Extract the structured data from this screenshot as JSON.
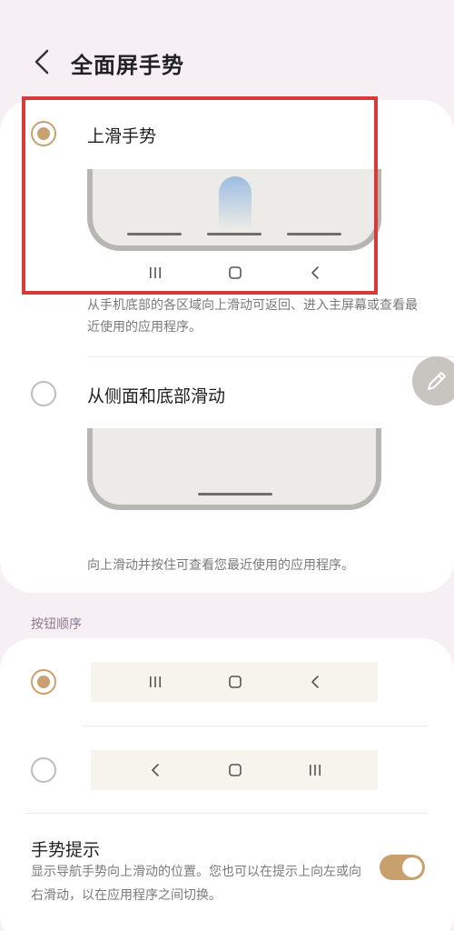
{
  "header": {
    "title": "全面屏手势",
    "back_icon": "chevron-left-icon"
  },
  "gesture_options": [
    {
      "label": "上滑手势",
      "selected": true,
      "description": "从手机底部的各区域向上滑动可返回、进入主屏幕或查看最近使用的应用程序。"
    },
    {
      "label": "从侧面和底部滑动",
      "selected": false,
      "description": "向上滑动并按住可查看您最近使用的应用程序。"
    }
  ],
  "nav_preview": {
    "keys": [
      "recents-icon",
      "home-icon",
      "back-icon"
    ]
  },
  "button_order": {
    "section_title": "按钮顺序",
    "options": [
      {
        "selected": true,
        "keys": [
          "recents-icon",
          "home-icon",
          "back-icon"
        ]
      },
      {
        "selected": false,
        "keys": [
          "back-icon",
          "home-icon",
          "recents-icon"
        ]
      }
    ]
  },
  "gesture_hint": {
    "title": "手势提示",
    "description": "显示导航手势向上滑动的位置。您也可以在提示上向左或向右滑动，以在应用程序之间切换。",
    "enabled": true
  },
  "colors": {
    "accent": "#c8a06e",
    "highlight_box": "#d83a3a",
    "background": "#f6eff4"
  }
}
